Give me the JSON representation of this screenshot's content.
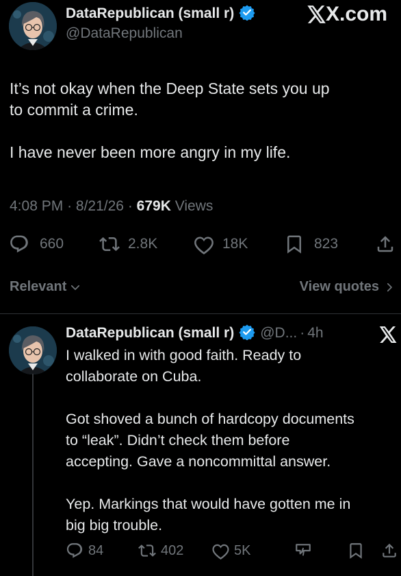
{
  "tweet": {
    "display_name": "DataRepublican (small r)",
    "handle": "@DataRepublican",
    "source_label": "X.com",
    "text": "It’s not okay when the Deep State sets you up\nto commit a crime.\n\nI have never been more angry in my life.",
    "time": "4:08 PM",
    "date": "8/21/26",
    "views_count": "679K",
    "views_label": "Views",
    "replies": "660",
    "reposts": "2.8K",
    "likes": "18K",
    "bookmarks": "823"
  },
  "filter": {
    "sort_label": "Relevant",
    "view_quotes_label": "View quotes"
  },
  "reply": {
    "display_name": "DataRepublican (small r)",
    "handle_short": "@D...",
    "age": "4h",
    "text": "I walked in with good faith. Ready to\ncollaborate on Cuba.\n\nGot shoved a bunch of hardcopy documents\nto “leak”. Didn’t check them before\naccepting. Gave a noncommittal answer.\n\nYep. Markings that would have gotten me in\nbig big trouble.",
    "replies": "84",
    "reposts": "402",
    "likes": "5K"
  },
  "icons": {
    "verified": "verified-badge-icon",
    "reply": "reply-icon",
    "repost": "repost-icon",
    "like": "heart-icon",
    "bookmark": "bookmark-icon",
    "share": "share-icon",
    "grok": "grok-icon",
    "x_logo": "x-logo-icon",
    "chevron_down": "chevron-down-icon",
    "chevron_right": "chevron-right-icon"
  },
  "colors": {
    "background": "#000000",
    "text": "#e7e9ea",
    "muted": "#71767b",
    "verified": "#1d9bf0"
  }
}
